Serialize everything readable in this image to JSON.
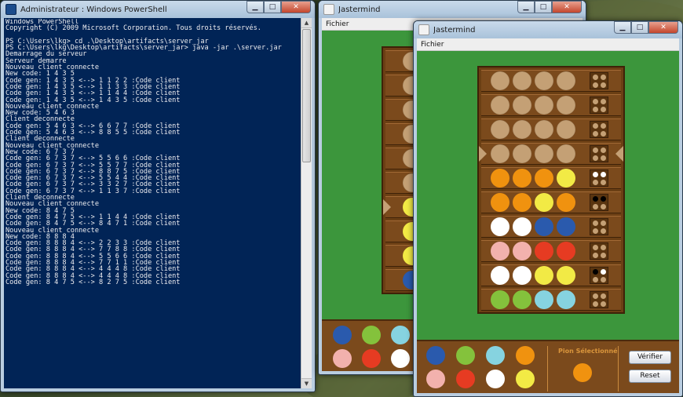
{
  "colors": {
    "brown": "#c4a075",
    "orange": "#f0920f",
    "yellow": "#f2ea45",
    "white": "#ffffff",
    "blue": "#2a5aad",
    "pink": "#f2b1ad",
    "red": "#e63b22",
    "green": "#84c23c",
    "cyan": "#86d3e0",
    "black": "#000000"
  },
  "powershell": {
    "title": "Administrateur : Windows PowerShell",
    "lines": [
      "Windows PowerShell",
      "Copyright (C) 2009 Microsoft Corporation. Tous droits réservés.",
      "",
      "PS C:\\Users\\lkg> cd .\\Desktop\\artifacts\\server_jar",
      "PS C:\\Users\\lkg\\Desktop\\artifacts\\server_jar> java -jar .\\server.jar",
      "Demarrage du serveur",
      "Serveur demarre",
      "Nouveau client connecte",
      "New code: 1 4 3 5",
      "Code gen: 1 4 3 5 <--> 1 1 2 2 :Code client",
      "Code gen: 1 4 3 5 <--> 1 1 3 3 :Code client",
      "Code gen: 1 4 3 5 <--> 1 1 4 4 :Code client",
      "Code gen: 1 4 3 5 <--> 1 4 3 5 :Code client",
      "Nouveau client connecte",
      "New code: 5 4 6 3",
      "Client deconnecte",
      "Code gen: 5 4 6 3 <--> 6 6 7 7 :Code client",
      "Code gen: 5 4 6 3 <--> 8 8 5 5 :Code client",
      "Client deconnecte",
      "Nouveau client connecte",
      "New code: 6 7 3 7",
      "Code gen: 6 7 3 7 <--> 5 5 6 6 :Code client",
      "Code gen: 6 7 3 7 <--> 5 5 7 7 :Code client",
      "Code gen: 6 7 3 7 <--> 8 8 7 5 :Code client",
      "Code gen: 6 7 3 7 <--> 5 5 4 4 :Code client",
      "Code gen: 6 7 3 7 <--> 3 3 2 7 :Code client",
      "Code gen: 6 7 3 7 <--> 1 1 3 7 :Code client",
      "Client deconnecte",
      "Nouveau client connecte",
      "New code: 8 4 7 5",
      "Code gen: 8 4 7 5 <--> 1 1 4 4 :Code client",
      "Code gen: 8 4 7 5 <--> 8 4 7 1 :Code client",
      "Nouveau client connecte",
      "New code: 8 8 8 4",
      "Code gen: 8 8 8 4 <--> 2 2 3 3 :Code client",
      "Code gen: 8 8 8 4 <--> 7 7 8 8 :Code client",
      "Code gen: 8 8 8 4 <--> 5 5 6 6 :Code client",
      "Code gen: 8 8 8 4 <--> 7 7 1 1 :Code client",
      "Code gen: 8 8 8 4 <--> 4 4 4 8 :Code client",
      "Code gen: 8 8 8 4 <--> 4 4 4 8 :Code client",
      "Code gen: 8 4 7 5 <--> 8 2 7 5 :Code client"
    ]
  },
  "jastermind_back": {
    "title": "Jastermind",
    "menu": "Fichier",
    "arrow_row": 6,
    "rows": [
      "brown",
      "brown",
      "brown",
      "brown",
      "brown",
      "brown",
      "yellow",
      "yellow",
      "yellow",
      "blue"
    ],
    "palette": [
      "blue",
      "green",
      "cyan",
      "pink",
      "red",
      "white"
    ]
  },
  "jastermind": {
    "title": "Jastermind",
    "menu": "Fichier",
    "arrow_row": 3,
    "rows": [
      {
        "pegs": [
          "brown",
          "brown",
          "brown",
          "brown"
        ],
        "feedback": [
          "brown",
          "brown",
          "brown",
          "brown"
        ]
      },
      {
        "pegs": [
          "brown",
          "brown",
          "brown",
          "brown"
        ],
        "feedback": [
          "brown",
          "brown",
          "brown",
          "brown"
        ]
      },
      {
        "pegs": [
          "brown",
          "brown",
          "brown",
          "brown"
        ],
        "feedback": [
          "brown",
          "brown",
          "brown",
          "brown"
        ]
      },
      {
        "pegs": [
          "brown",
          "brown",
          "brown",
          "brown"
        ],
        "feedback": [
          "brown",
          "brown",
          "brown",
          "brown"
        ]
      },
      {
        "pegs": [
          "orange",
          "orange",
          "orange",
          "yellow"
        ],
        "feedback": [
          "white",
          "white",
          "brown",
          "brown"
        ]
      },
      {
        "pegs": [
          "orange",
          "orange",
          "yellow",
          "orange"
        ],
        "feedback": [
          "black",
          "black",
          "brown",
          "brown"
        ]
      },
      {
        "pegs": [
          "white",
          "white",
          "blue",
          "blue"
        ],
        "feedback": [
          "brown",
          "brown",
          "brown",
          "brown"
        ]
      },
      {
        "pegs": [
          "pink",
          "pink",
          "red",
          "red"
        ],
        "feedback": [
          "brown",
          "brown",
          "brown",
          "brown"
        ]
      },
      {
        "pegs": [
          "white",
          "white",
          "yellow",
          "yellow"
        ],
        "feedback": [
          "black",
          "white",
          "brown",
          "brown"
        ]
      },
      {
        "pegs": [
          "green",
          "green",
          "cyan",
          "cyan"
        ],
        "feedback": [
          "brown",
          "brown",
          "brown",
          "brown"
        ]
      }
    ],
    "palette": [
      "blue",
      "green",
      "cyan",
      "orange",
      "pink",
      "red",
      "white",
      "yellow"
    ],
    "selected_label": "Pion Sélectionné",
    "selected_color": "orange",
    "verify_label": "Vérifier",
    "reset_label": "Reset"
  }
}
